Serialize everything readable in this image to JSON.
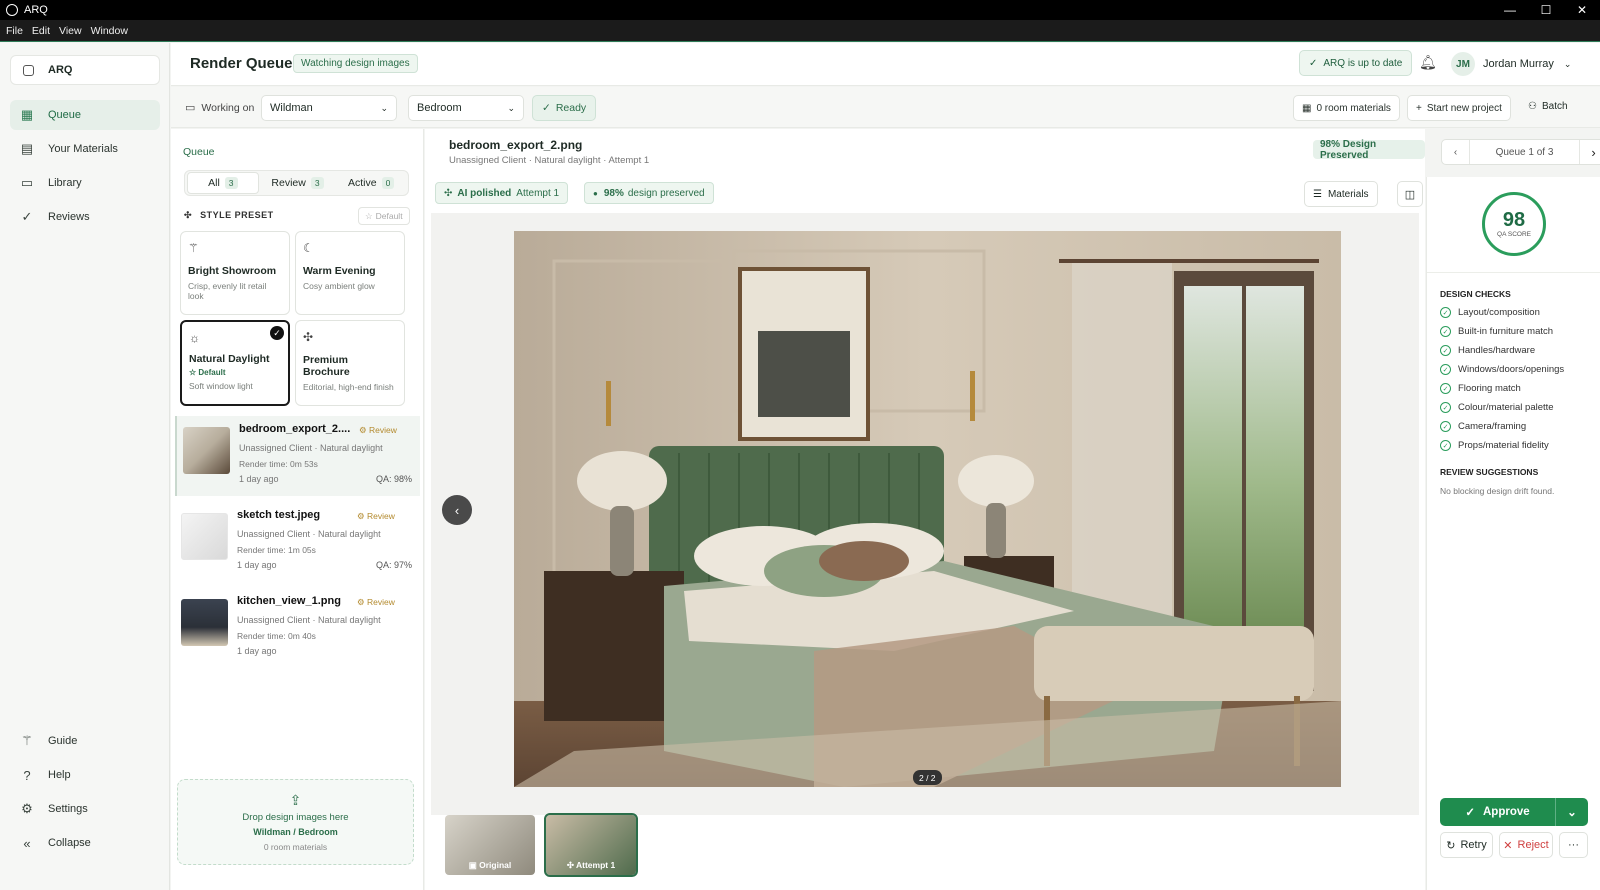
{
  "window": {
    "title": "ARQ",
    "minimize": "—",
    "maximize": "☐",
    "close": "✕"
  },
  "menu": [
    "File",
    "Edit",
    "View",
    "Window"
  ],
  "sidebar": {
    "brand": "ARQ",
    "items": [
      {
        "label": "Queue",
        "icon": "grid-icon"
      },
      {
        "label": "Your Materials",
        "icon": "table-icon"
      },
      {
        "label": "Library",
        "icon": "folder-icon"
      },
      {
        "label": "Reviews",
        "icon": "check-icon"
      }
    ],
    "bottom": [
      {
        "label": "Guide",
        "icon": "wand-icon"
      },
      {
        "label": "Help",
        "icon": "help-icon"
      },
      {
        "label": "Settings",
        "icon": "gear-icon"
      },
      {
        "label": "Collapse",
        "icon": "double-chevron-left-icon"
      }
    ]
  },
  "header": {
    "title": "Render Queue",
    "watching": "Watching design images",
    "uptodate": "ARQ is up to date",
    "user_initials": "JM",
    "user_name": "Jordan Murray"
  },
  "toolbar": {
    "working_on": "Working on",
    "project": "Wildman",
    "room": "Bedroom",
    "status": "Ready",
    "room_materials": "0 room materials",
    "new_project": "Start new project",
    "batch": "Batch"
  },
  "queue": {
    "heading": "Queue",
    "tabs": [
      {
        "label": "All",
        "count": "3"
      },
      {
        "label": "Review",
        "count": "3"
      },
      {
        "label": "Active",
        "count": "0"
      }
    ],
    "style_preset_label": "STYLE PRESET",
    "default_label": "Default",
    "presets": [
      {
        "name": "Bright Showroom",
        "desc": "Crisp, evenly lit retail look"
      },
      {
        "name": "Warm Evening",
        "desc": "Cosy ambient glow"
      },
      {
        "name": "Natural Daylight",
        "default_tag": "Default",
        "desc": "Soft window light"
      },
      {
        "name": "Premium Brochure",
        "desc": "Editorial, high-end finish"
      }
    ],
    "items": [
      {
        "name": "bedroom_export_2....",
        "status": "Review",
        "meta": "Unassigned Client · Natural daylight",
        "render": "Render time: 0m 53s",
        "ago": "1 day ago",
        "qa": "QA: 98%"
      },
      {
        "name": "sketch test.jpeg",
        "status": "Review",
        "meta": "Unassigned Client · Natural daylight",
        "render": "Render time: 1m 05s",
        "ago": "1 day ago",
        "qa": "QA: 97%"
      },
      {
        "name": "kitchen_view_1.png",
        "status": "Review",
        "meta": "Unassigned Client · Natural daylight",
        "render": "Render time: 0m 40s",
        "ago": "1 day ago",
        "qa": ""
      }
    ],
    "drop": {
      "line1": "Drop design images here",
      "line2": "Wildman / Bedroom",
      "line3": "0 room materials"
    }
  },
  "viewer": {
    "filename": "bedroom_export_2.png",
    "subtitle": "Unassigned Client · Natural daylight · Attempt 1",
    "preserved_chip": "98% Design Preserved",
    "pager": "Queue 1 of 3",
    "polished": "AI polished",
    "attempt": "Attempt 1",
    "preserved_pct": "98%",
    "preserved_text": "design preserved",
    "materials": "Materials",
    "counter": "2 / 2",
    "thumbs": [
      {
        "label": "Original"
      },
      {
        "label": "Attempt 1"
      }
    ]
  },
  "qa": {
    "score": "98",
    "score_label": "QA SCORE",
    "checks_heading": "DESIGN CHECKS",
    "checks": [
      "Layout/composition",
      "Built-in furniture match",
      "Handles/hardware",
      "Windows/doors/openings",
      "Flooring match",
      "Colour/material palette",
      "Camera/framing",
      "Props/material fidelity"
    ],
    "suggestions_heading": "REVIEW SUGGESTIONS",
    "suggestions": "No blocking design drift found."
  },
  "actions": {
    "approve": "Approve",
    "retry": "Retry",
    "reject": "Reject",
    "more": "···"
  },
  "colors": {
    "accent": "#1f8c4e",
    "accent_dark": "#1f6b45",
    "review": "#b38a2e",
    "reject": "#d04040"
  }
}
